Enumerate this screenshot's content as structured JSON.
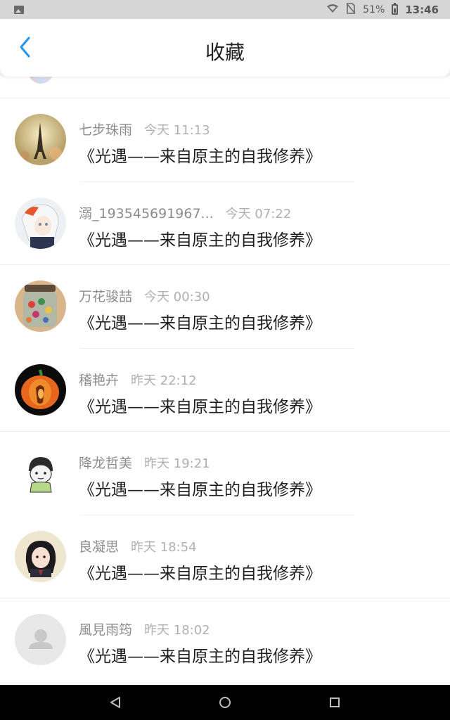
{
  "status_bar": {
    "battery": "51%",
    "time": "13:46"
  },
  "header": {
    "title": "收藏"
  },
  "items": [
    {
      "username": "七步珠雨",
      "time": "今天 11:13",
      "title": "《光遇——来自原主的自我修养》",
      "avatar": "eiffel-tower-avatar"
    },
    {
      "username": "溺_193545691967...",
      "time": "今天 07:22",
      "title": "《光遇——来自原主的自我修养》",
      "avatar": "anime-girl-avatar"
    },
    {
      "username": "万花骏喆",
      "time": "今天 00:30",
      "title": "《光遇——来自原主的自我修养》",
      "avatar": "candy-jar-avatar"
    },
    {
      "username": "稽艳卉",
      "time": "昨天 22:12",
      "title": "《光遇——来自原主的自我修养》",
      "avatar": "pumpkin-avatar"
    },
    {
      "username": "降龙哲美",
      "time": "昨天 19:21",
      "title": "《光遇——来自原主的自我修养》",
      "avatar": "cartoon-boy-avatar"
    },
    {
      "username": "良凝思",
      "time": "昨天 18:54",
      "title": "《光遇——来自原主的自我修养》",
      "avatar": "girl-photo-avatar"
    },
    {
      "username": "風見雨筠",
      "time": "昨天 18:02",
      "title": "《光遇——来自原主的自我修养》",
      "avatar": "default-user-avatar"
    }
  ],
  "colors": {
    "accent": "#2196f3",
    "background": "#f4f4f4",
    "status_bar": "#d6d6d6",
    "nav_bar": "#000000"
  }
}
